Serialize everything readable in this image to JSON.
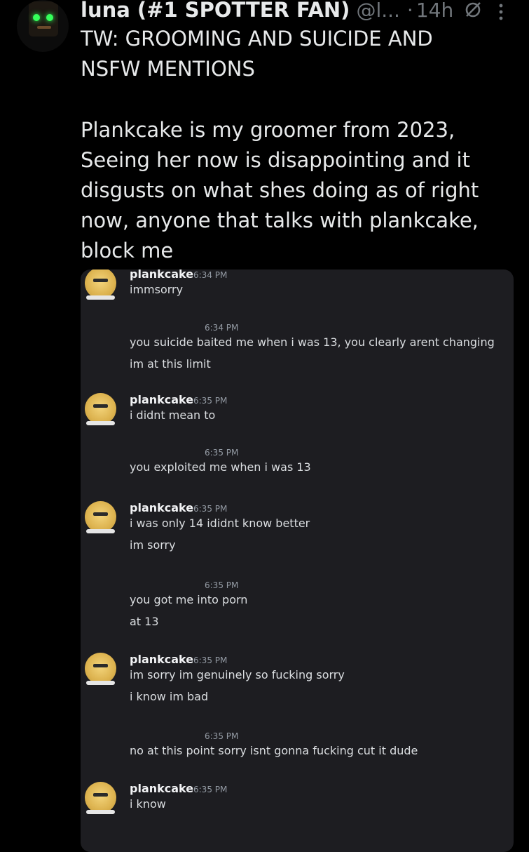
{
  "tweet": {
    "display_name": "luna (#1 SPOTTER FAN)",
    "handle": "@l...",
    "separator": "·",
    "time": "14h",
    "warning": "TW: GROOMING AND SUICIDE AND\nNSFW MENTIONS",
    "body": "Plankcake is my groomer from 2023,\nSeeing her now is disappointing and it\ndisgusts on what shes doing as of right\nnow, anyone that talks with plankcake,\nblock me",
    "icons": {
      "avatar": "profile-avatar",
      "grok": "grok-icon",
      "more": "more-options-icon"
    }
  },
  "chat": {
    "messages": [
      {
        "author": "plankcake",
        "time": "6:34 PM",
        "lines": [
          "immsorry"
        ]
      },
      {
        "author": "",
        "time": "6:34 PM",
        "lines": [
          "you suicide baited me when i was 13, you clearly arent changing",
          "im at this limit"
        ]
      },
      {
        "author": "plankcake",
        "time": "6:35 PM",
        "lines": [
          "i didnt mean to"
        ]
      },
      {
        "author": "",
        "time": "6:35 PM",
        "lines": [
          "you exploited me when i was 13"
        ]
      },
      {
        "author": "plankcake",
        "time": "6:35 PM",
        "lines": [
          "i was only 14 ididnt know better",
          "im sorry"
        ]
      },
      {
        "author": "",
        "time": "6:35 PM",
        "lines": [
          "you got me into porn",
          "at 13"
        ]
      },
      {
        "author": "plankcake",
        "time": "6:35 PM",
        "lines": [
          "im sorry im genuinely so fucking sorry",
          "i know im bad"
        ]
      },
      {
        "author": "",
        "time": "6:35 PM",
        "lines": [
          "no at this point sorry isnt gonna fucking cut it dude"
        ]
      },
      {
        "author": "plankcake",
        "time": "6:35 PM",
        "lines": [
          "i know"
        ]
      }
    ]
  }
}
